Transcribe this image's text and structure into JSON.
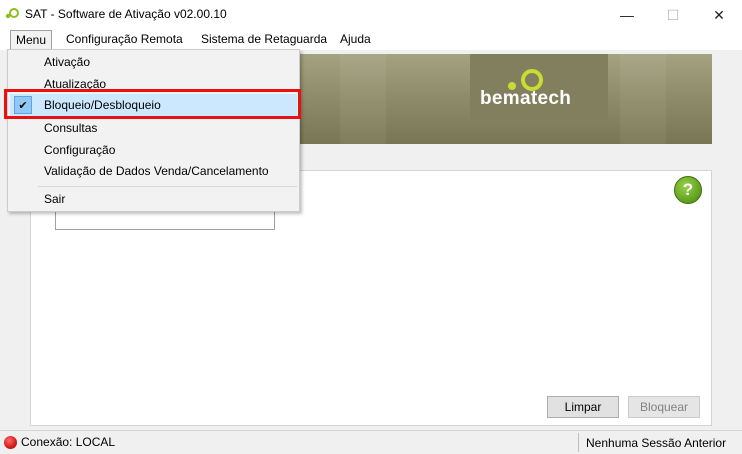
{
  "window": {
    "title": "SAT - Software de Ativação v02.00.10",
    "controls": {
      "minimize": "—",
      "maximize": "☐",
      "close": "✕"
    }
  },
  "menubar": {
    "items": [
      {
        "label": "Menu",
        "state": "open"
      },
      {
        "label": "Configuração Remota"
      },
      {
        "label": "Sistema de Retaguarda"
      },
      {
        "label": "Ajuda"
      }
    ]
  },
  "dropdown": {
    "items": [
      {
        "label": "Ativação"
      },
      {
        "label": "Atualização"
      },
      {
        "label": "Bloqueio/Desbloqueio",
        "checked": true,
        "check_glyph": "✔"
      },
      {
        "label": "Consultas"
      },
      {
        "label": "Configuração"
      },
      {
        "label": "Validação de Dados Venda/Cancelamento"
      },
      {
        "label": "Sair"
      }
    ]
  },
  "banner": {
    "brand": "bematech"
  },
  "panel": {
    "help_glyph": "?",
    "buttons": {
      "clear": "Limpar",
      "block": "Bloquear"
    }
  },
  "status": {
    "connection": "Conexão: LOCAL",
    "session": "Nenhuma Sessão Anterior"
  },
  "colors": {
    "highlight": "#e81010",
    "brand_accent": "#c8dc32",
    "help_green": "#5c9e1e",
    "led_red": "#d21b1b",
    "checked_bg": "#cce8ff"
  },
  "icons": {
    "app": "sat-logo-icon",
    "help": "help-question-icon",
    "status": "connection-led-icon",
    "check": "checkmark-icon"
  }
}
